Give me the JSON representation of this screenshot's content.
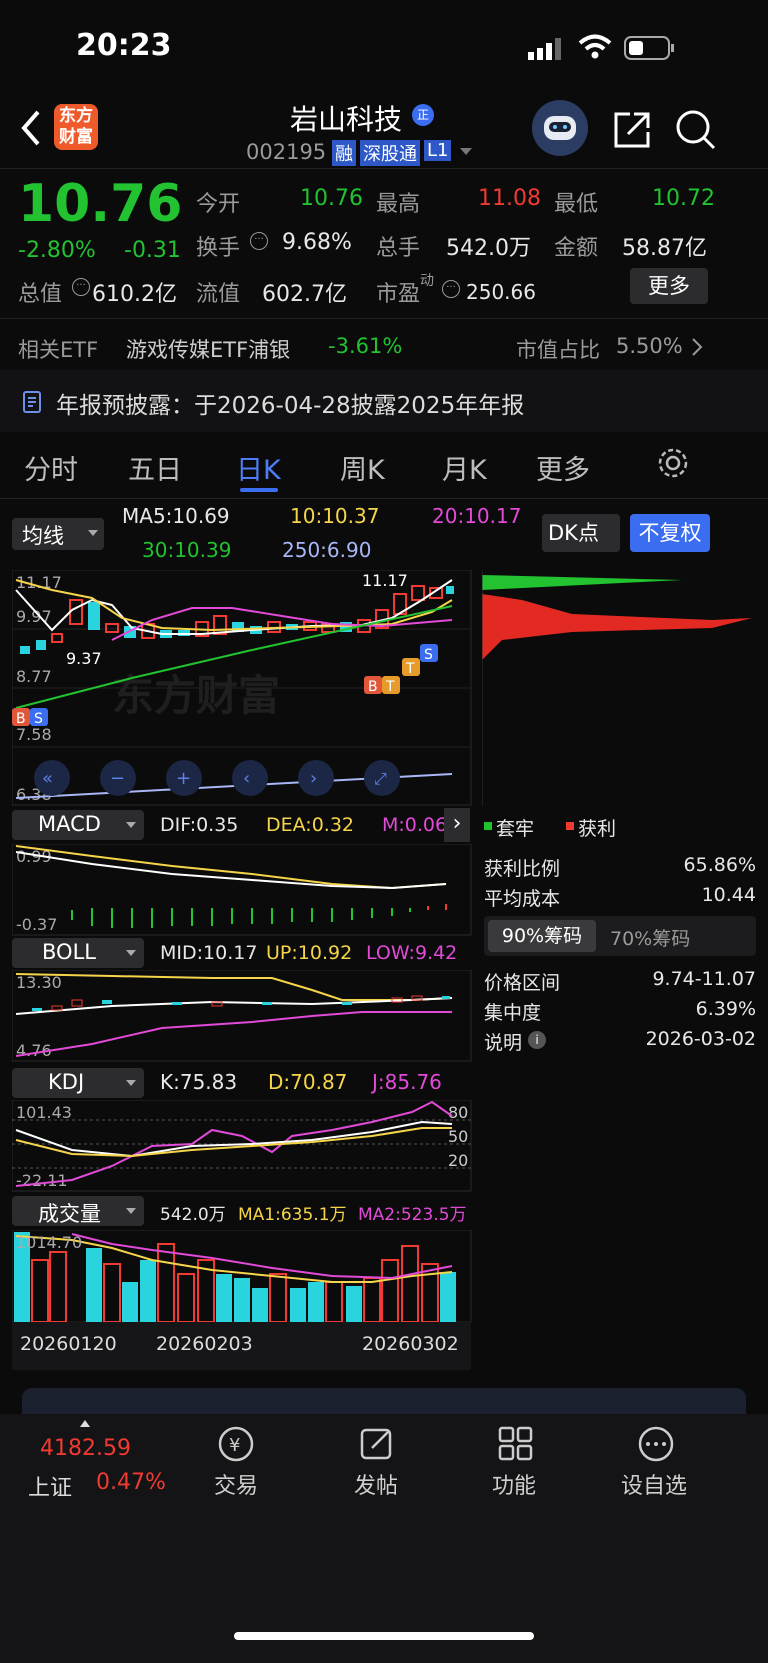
{
  "status": {
    "time": "20:23"
  },
  "header": {
    "logo": "东方\n财富",
    "name": "岩山科技",
    "code": "002195",
    "tags": [
      "融",
      "深股通",
      "L1"
    ]
  },
  "quote": {
    "price": "10.76",
    "pct": "-2.80%",
    "chg": "-0.31",
    "r1": {
      "l1": "今开",
      "v1": "10.76",
      "l2": "最高",
      "v2": "11.08",
      "l3": "最低",
      "v3": "10.72"
    },
    "r2": {
      "l1": "换手",
      "v1": "9.68%",
      "l2": "总手",
      "v2": "542.0万",
      "l3": "金额",
      "v3": "58.87亿"
    },
    "r3": {
      "l1": "总值",
      "v1": "610.2亿",
      "l2": "流值",
      "v2": "602.7亿",
      "l3": "市盈",
      "l3s": "动",
      "v3": "250.66"
    },
    "more": "更多"
  },
  "etf": {
    "label": "相关ETF",
    "name": "游戏传媒ETF浦银",
    "pct": "-3.61%",
    "share_label": "市值占比",
    "share": "5.50%"
  },
  "notice": "年报预披露：于2026-04-28披露2025年年报",
  "tabs": [
    "分时",
    "五日",
    "日K",
    "周K",
    "月K",
    "更多"
  ],
  "ma": {
    "sel": "均线",
    "ma5": "MA5:10.69",
    "ma10": "10:10.37",
    "ma20": "20:10.17",
    "ma30": "30:10.39",
    "ma250": "250:6.90",
    "dk": "DK点",
    "fq": "不复权"
  },
  "kchart": {
    "yticks": [
      "11.17",
      "9.97",
      "8.77",
      "7.58",
      "6.38"
    ],
    "hi": "11.17",
    "lo": "9.37"
  },
  "macd": {
    "sel": "MACD",
    "dif": "DIF:0.35",
    "dea": "DEA:0.32",
    "m": "M:0.06",
    "ytop": "0.99",
    "ybot": "-0.37"
  },
  "boll": {
    "sel": "BOLL",
    "mid": "MID:10.17",
    "up": "UP:10.92",
    "low": "LOW:9.42",
    "ytop": "13.30",
    "ybot": "4.76"
  },
  "kdj": {
    "sel": "KDJ",
    "k": "K:75.83",
    "d": "D:70.87",
    "j": "J:85.76",
    "ytop": "101.43",
    "ybot": "-22.11",
    "lv": [
      "80",
      "50",
      "20"
    ]
  },
  "vol": {
    "sel": "成交量",
    "v": "542.0万",
    "ma1": "MA1:635.1万",
    "ma2": "MA2:523.5万",
    "ytop": "1014.70",
    "dates": [
      "20260120",
      "20260203",
      "20260302"
    ]
  },
  "chips": {
    "leg1": "套牢",
    "leg2": "获利",
    "ratio_l": "获利比例",
    "ratio": "65.86%",
    "cost_l": "平均成本",
    "cost": "10.44",
    "t1": "90%筹码",
    "t2": "70%筹码",
    "range_l": "价格区间",
    "range": "9.74-11.07",
    "conc_l": "集中度",
    "conc": "6.39%",
    "desc_l": "说明",
    "desc": "2026-03-02"
  },
  "bottom": {
    "index": "4182.59",
    "index_name": "上证",
    "index_pct": "0.47%",
    "n1": "交易",
    "n2": "发帖",
    "n3": "功能",
    "n4": "设自选"
  },
  "colors": {
    "up": "#f03a32",
    "down": "#22c230",
    "accent": "#3a6df0"
  }
}
